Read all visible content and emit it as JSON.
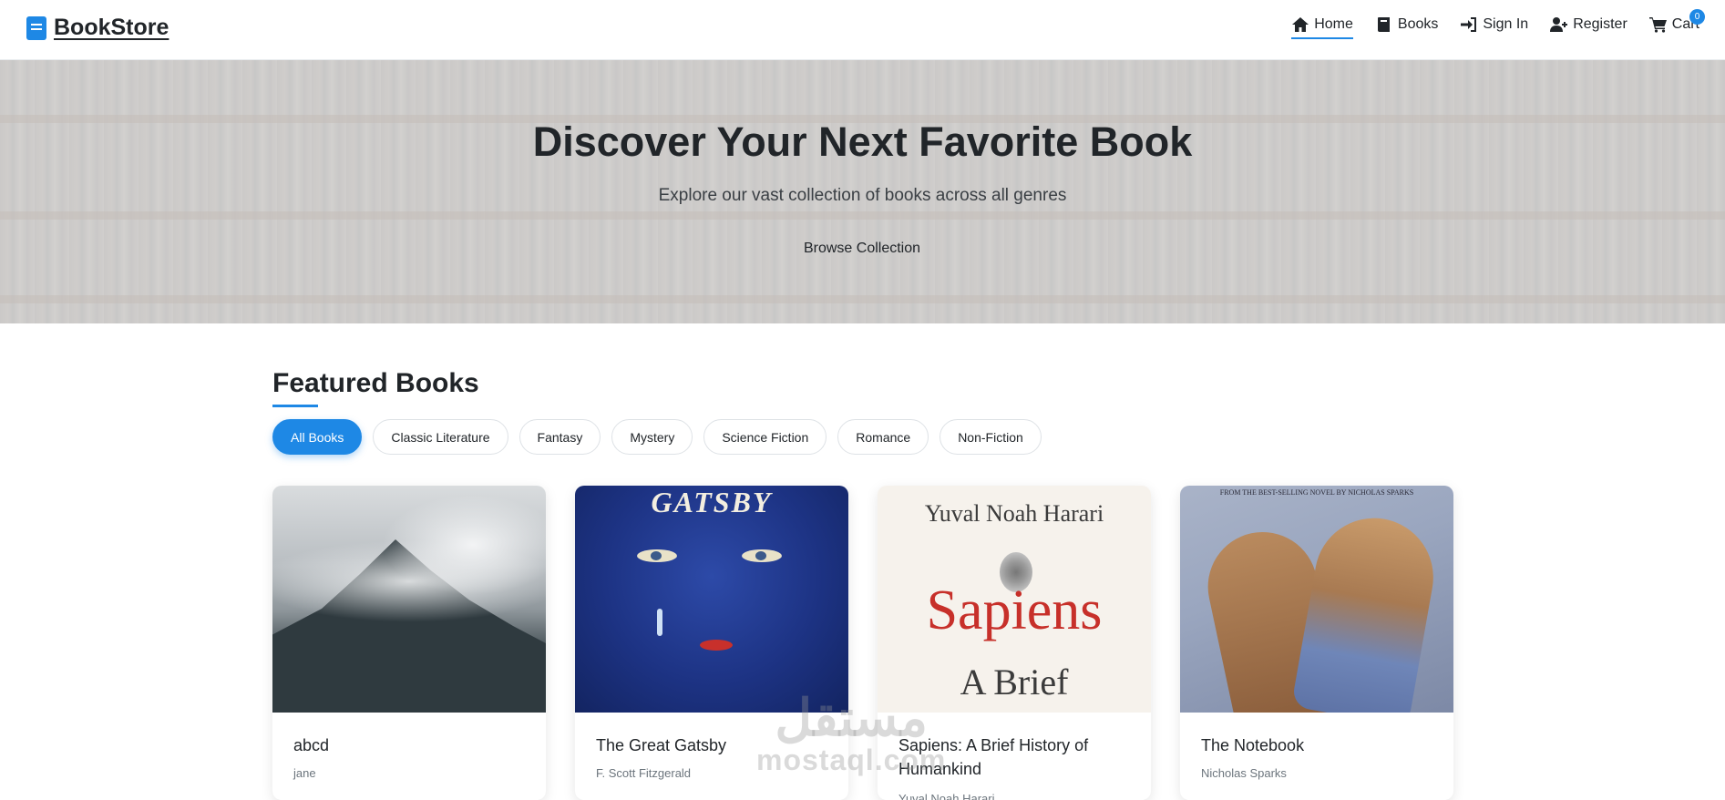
{
  "brand": {
    "name": "BookStore",
    "icon": "book-icon",
    "accent": "#1e88e5"
  },
  "nav": {
    "home": {
      "label": "Home",
      "icon": "home-icon"
    },
    "books": {
      "label": "Books",
      "icon": "book-icon"
    },
    "signin": {
      "label": "Sign In",
      "icon": "sign-in-icon"
    },
    "register": {
      "label": "Register",
      "icon": "user-plus-icon"
    },
    "cart": {
      "label": "Cart",
      "icon": "cart-icon",
      "count": "0"
    }
  },
  "hero": {
    "title": "Discover Your Next Favorite Book",
    "subtitle": "Explore our vast collection of books across all genres",
    "button": "Browse Collection"
  },
  "featured": {
    "title": "Featured Books",
    "filters": [
      "All Books",
      "Classic Literature",
      "Fantasy",
      "Mystery",
      "Science Fiction",
      "Romance",
      "Non-Fiction"
    ],
    "active_filter": "All Books",
    "books": [
      {
        "title": "abcd",
        "author": "jane"
      },
      {
        "title": "The Great Gatsby",
        "author": "F. Scott Fitzgerald",
        "cover_text": "GATSBY"
      },
      {
        "title": "Sapiens: A Brief History of Humankind",
        "author": "Yuval Noah Harari",
        "cover_author": "Yuval Noah Harari",
        "cover_title": "Sapiens",
        "cover_subtitle": "A Brief"
      },
      {
        "title": "The Notebook",
        "author": "Nicholas Sparks",
        "cover_tagline": "FROM THE BEST-SELLING NOVEL BY NICHOLAS SPARKS"
      }
    ]
  },
  "watermark": {
    "arabic": "مستقل",
    "latin": "mostaql.com"
  }
}
